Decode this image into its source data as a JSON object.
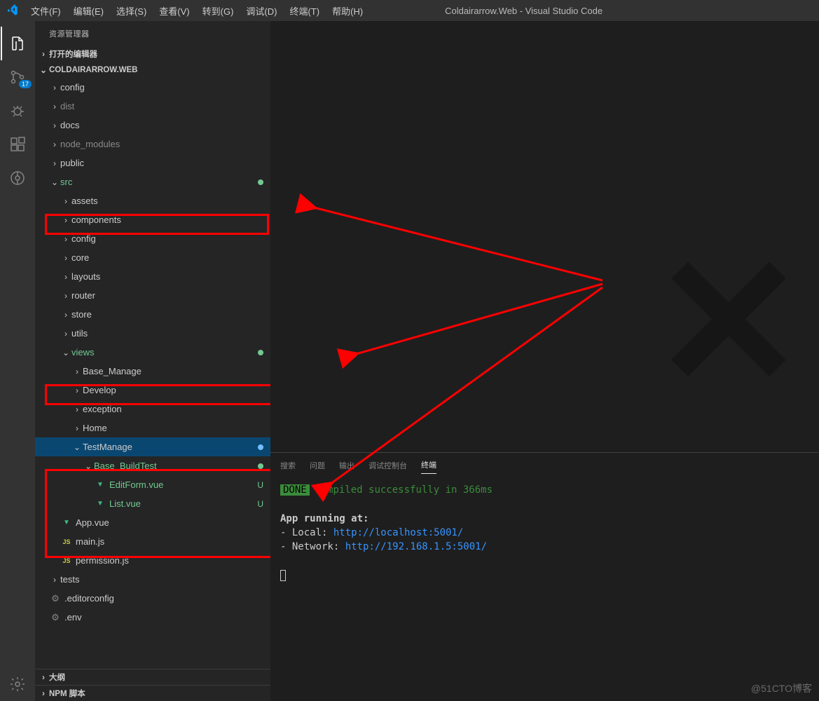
{
  "window_title": "Coldairarrow.Web - Visual Studio Code",
  "menu": [
    "文件(F)",
    "编辑(E)",
    "选择(S)",
    "查看(V)",
    "转到(G)",
    "调试(D)",
    "终端(T)",
    "帮助(H)"
  ],
  "activity": {
    "scm_badge": "17"
  },
  "explorer": {
    "title": "资源管理器",
    "sections": {
      "open_editors": "打开的编辑器",
      "project": "COLDAIRARROW.WEB",
      "outline": "大纲",
      "npm": "NPM 脚本"
    },
    "items": {
      "config": "config",
      "dist": "dist",
      "docs": "docs",
      "node_modules": "node_modules",
      "public": "public",
      "src": "src",
      "assets": "assets",
      "components": "components",
      "config2": "config",
      "core": "core",
      "layouts": "layouts",
      "router": "router",
      "store": "store",
      "utils": "utils",
      "views": "views",
      "base_manage": "Base_Manage",
      "develop": "Develop",
      "exception": "exception",
      "home": "Home",
      "testmanage": "TestManage",
      "base_buildtest": "Base_BuildTest",
      "editform": "EditForm.vue",
      "list": "List.vue",
      "app": "App.vue",
      "mainjs": "main.js",
      "permission": "permission.js",
      "tests": "tests",
      "editorconfig": ".editorconfig",
      "env": ".env"
    }
  },
  "panel": {
    "tabs": [
      "搜索",
      "问题",
      "输出",
      "调试控制台",
      "终端"
    ],
    "done_badge": "DONE",
    "compiled": "Compiled successfully in 366ms",
    "running": "App running at:",
    "local_label": "- Local:   ",
    "local_url": "http://localhost:5001/",
    "network_label": "- Network: ",
    "network_url": "http://192.168.1.5:5001/"
  },
  "watermark": "@51CTO博客"
}
